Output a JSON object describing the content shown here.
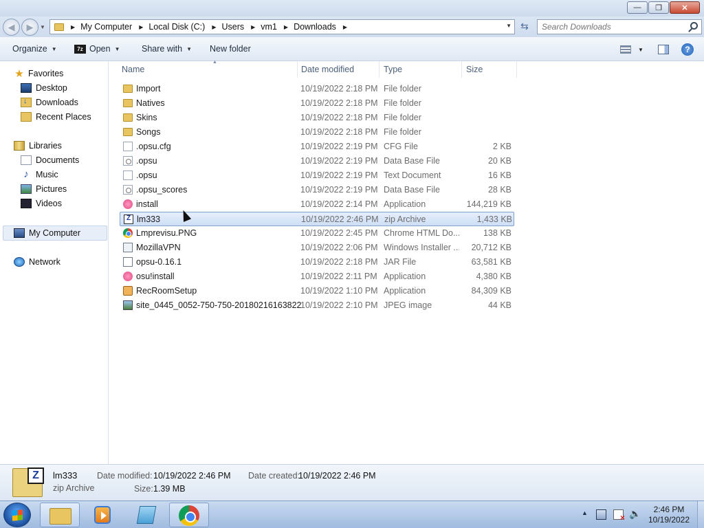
{
  "window": {
    "controls": {
      "minimize": "—",
      "maximize": "❐",
      "close": "✕"
    }
  },
  "address": {
    "crumbs": [
      "My Computer",
      "Local Disk (C:)",
      "Users",
      "vm1",
      "Downloads"
    ],
    "search_placeholder": "Search Downloads"
  },
  "toolbar": {
    "organize": "Organize",
    "open": "Open",
    "share": "Share with",
    "new_folder": "New folder",
    "help_glyph": "?"
  },
  "sidebar": {
    "favorites": "Favorites",
    "desktop": "Desktop",
    "downloads": "Downloads",
    "recent": "Recent Places",
    "libraries": "Libraries",
    "documents": "Documents",
    "music": "Music",
    "pictures": "Pictures",
    "videos": "Videos",
    "computer": "My Computer",
    "network": "Network"
  },
  "columns": {
    "name": "Name",
    "date": "Date modified",
    "type": "Type",
    "size": "Size"
  },
  "files": [
    {
      "name": "Import",
      "date": "10/19/2022 2:18 PM",
      "type": "File folder",
      "size": "",
      "icon": "folder-icon"
    },
    {
      "name": "Natives",
      "date": "10/19/2022 2:18 PM",
      "type": "File folder",
      "size": "",
      "icon": "folder-icon"
    },
    {
      "name": "Skins",
      "date": "10/19/2022 2:18 PM",
      "type": "File folder",
      "size": "",
      "icon": "folder-icon"
    },
    {
      "name": "Songs",
      "date": "10/19/2022 2:18 PM",
      "type": "File folder",
      "size": "",
      "icon": "folder-icon"
    },
    {
      "name": ".opsu.cfg",
      "date": "10/19/2022 2:19 PM",
      "type": "CFG File",
      "size": "2 KB",
      "icon": "file-icon"
    },
    {
      "name": ".opsu",
      "date": "10/19/2022 2:19 PM",
      "type": "Data Base File",
      "size": "20 KB",
      "icon": "database-file-icon"
    },
    {
      "name": ".opsu",
      "date": "10/19/2022 2:19 PM",
      "type": "Text Document",
      "size": "16 KB",
      "icon": "text-file-icon"
    },
    {
      "name": ".opsu_scores",
      "date": "10/19/2022 2:19 PM",
      "type": "Data Base File",
      "size": "28 KB",
      "icon": "database-file-icon"
    },
    {
      "name": "install",
      "date": "10/19/2022 2:14 PM",
      "type": "Application",
      "size": "144,219 KB",
      "icon": "osu-icon"
    },
    {
      "name": "lm333",
      "date": "10/19/2022 2:46 PM",
      "type": "zip Archive",
      "size": "1,433 KB",
      "icon": "zip-icon"
    },
    {
      "name": "Lmprevisu.PNG",
      "date": "10/19/2022 2:45 PM",
      "type": "Chrome HTML Do...",
      "size": "138 KB",
      "icon": "chrome-icon"
    },
    {
      "name": "MozillaVPN",
      "date": "10/19/2022 2:06 PM",
      "type": "Windows Installer ...",
      "size": "20,712 KB",
      "icon": "installer-icon"
    },
    {
      "name": "opsu-0.16.1",
      "date": "10/19/2022 2:18 PM",
      "type": "JAR File",
      "size": "63,581 KB",
      "icon": "jar-icon"
    },
    {
      "name": "osu!install",
      "date": "10/19/2022 2:11 PM",
      "type": "Application",
      "size": "4,380 KB",
      "icon": "osu-icon"
    },
    {
      "name": "RecRoomSetup",
      "date": "10/19/2022 1:10 PM",
      "type": "Application",
      "size": "84,309 KB",
      "icon": "recroom-icon"
    },
    {
      "name": "site_0445_0052-750-750-20180216163822",
      "date": "10/19/2022 2:10 PM",
      "type": "JPEG image",
      "size": "44 KB",
      "icon": "image-icon"
    }
  ],
  "details": {
    "name": "lm333",
    "type": "zip Archive",
    "zip_badge": "Z",
    "modified_label": "Date modified:",
    "modified": "10/19/2022 2:46 PM",
    "created_label": "Date created:",
    "created": "10/19/2022 2:46 PM",
    "size_label": "Size:",
    "size": "1.39 MB"
  },
  "taskbar": {
    "time": "2:46 PM",
    "date": "10/19/2022"
  }
}
